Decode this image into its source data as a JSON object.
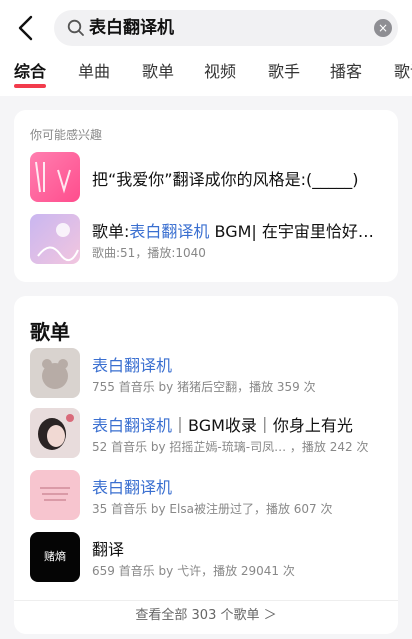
{
  "search": {
    "query": "表白翻译机",
    "clear_glyph": "×"
  },
  "tabs": [
    {
      "label": "综合",
      "active": true
    },
    {
      "label": "单曲"
    },
    {
      "label": "歌单"
    },
    {
      "label": "视频"
    },
    {
      "label": "歌手"
    },
    {
      "label": "播客"
    },
    {
      "label": "歌词"
    }
  ],
  "suggest": {
    "heading": "你可能感兴趣",
    "items": [
      {
        "text": "把“我爱你”翻译成你的风格是:(_____)"
      },
      {
        "prefix": "歌单:",
        "highlight": "表白翻译机",
        "rest": " BGM| 在宇宙里恰好…",
        "sub": "歌曲:51，播放:1040"
      }
    ]
  },
  "playlists": {
    "title": "歌单",
    "items": [
      {
        "highlight": "表白翻译机",
        "rest": "",
        "sub": "755 首音乐  by 猪猪后空翻，播放 359 次"
      },
      {
        "highlight": "表白翻译机",
        "rest": "｜BGM收录｜你身上有光",
        "sub": "52 首音乐  by 招摇芷嫣-琉璃-司凤…  ，播放 242 次"
      },
      {
        "highlight": "表白翻译机",
        "rest": "",
        "sub": "35 首音乐  by Elsa被注册过了，播放 607 次"
      },
      {
        "highlight": "",
        "rest": "翻译",
        "sub": "659 首音乐  by 弋许，播放 29041 次",
        "cover_text": "赌熵"
      }
    ],
    "view_all": "查看全部 303 个歌单 ＞"
  },
  "colors": {
    "accent": "#f23b4c",
    "highlight": "#3a6fd0",
    "background": "#f5f5f7"
  },
  "icons": [
    "back-arrow-icon",
    "search-icon",
    "clear-icon"
  ]
}
